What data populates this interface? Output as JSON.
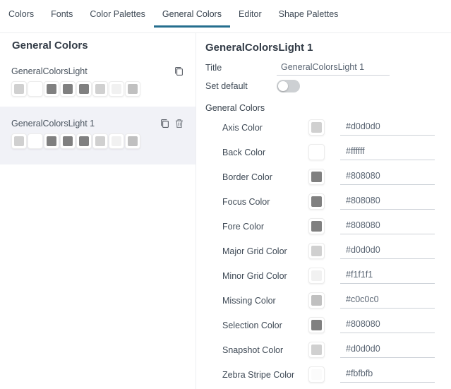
{
  "tabs": {
    "items": [
      {
        "label": "Colors"
      },
      {
        "label": "Fonts"
      },
      {
        "label": "Color Palettes"
      },
      {
        "label": "General Colors"
      },
      {
        "label": "Editor"
      },
      {
        "label": "Shape Palettes"
      }
    ],
    "active": "General Colors",
    "accent_color": "#256e8e"
  },
  "left_panel": {
    "heading": "General Colors",
    "items": [
      {
        "title": "GeneralColorsLight",
        "selected": false,
        "swatches": [
          "#d0d0d0",
          "#ffffff",
          "#808080",
          "#808080",
          "#808080",
          "#d0d0d0",
          "#f1f1f1",
          "#c0c0c0"
        ]
      },
      {
        "title": "GeneralColorsLight 1",
        "selected": true,
        "selected_bg": "#f1f2f7",
        "swatches": [
          "#d0d0d0",
          "#ffffff",
          "#808080",
          "#808080",
          "#808080",
          "#d0d0d0",
          "#f1f1f1",
          "#c0c0c0"
        ]
      }
    ]
  },
  "detail_panel": {
    "header": "GeneralColorsLight 1",
    "title_field": {
      "label": "Title",
      "value": "GeneralColorsLight 1"
    },
    "set_default": {
      "label": "Set default",
      "enabled": false
    },
    "section_heading": "General Colors",
    "rows": [
      {
        "label": "Axis Color",
        "value": "#d0d0d0"
      },
      {
        "label": "Back Color",
        "value": "#ffffff"
      },
      {
        "label": "Border Color",
        "value": "#808080"
      },
      {
        "label": "Focus Color",
        "value": "#808080"
      },
      {
        "label": "Fore Color",
        "value": "#808080"
      },
      {
        "label": "Major Grid Color",
        "value": "#d0d0d0"
      },
      {
        "label": "Minor Grid Color",
        "value": "#f1f1f1"
      },
      {
        "label": "Missing Color",
        "value": "#c0c0c0"
      },
      {
        "label": "Selection Color",
        "value": "#808080"
      },
      {
        "label": "Snapshot Color",
        "value": "#d0d0d0"
      },
      {
        "label": "Zebra Stripe Color",
        "value": "#fbfbfb"
      }
    ]
  }
}
